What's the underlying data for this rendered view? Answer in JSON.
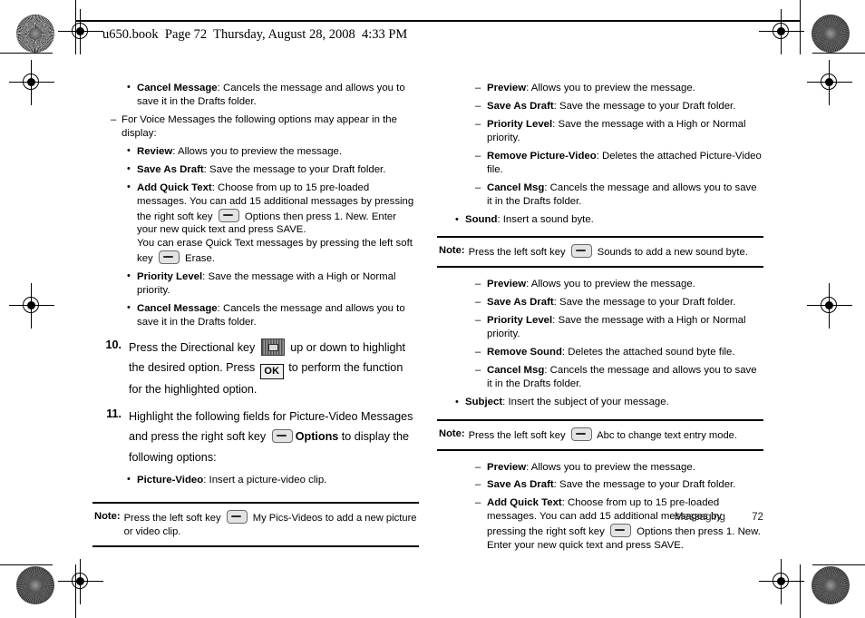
{
  "page": {
    "header_text": "u650.book  Page 72  Thursday, August 28, 2008  4:33 PM",
    "footer_chapter": "Messaging",
    "footer_pageno": "72"
  },
  "icons": {
    "soft_key": "soft-key-icon",
    "ok_key_label": "OK",
    "nav_key": "directional-key-icon"
  },
  "left_column": {
    "cancel_message_top": {
      "marker": "•",
      "term": "Cancel Message",
      "text": ": Cancels the message and allows you to save it in the Drafts folder."
    },
    "voice_intro": {
      "marker": "–",
      "text": "For Voice Messages the following options may appear in the display:"
    },
    "voice_options": [
      {
        "marker": "•",
        "term": "Review",
        "text": ": Allows you to preview the message."
      },
      {
        "marker": "•",
        "term": "Save As Draft",
        "text": ": Save the message to your Draft folder."
      }
    ],
    "add_quick_text": {
      "marker": "•",
      "term": "Add Quick Text",
      "part1": ": Choose from up to 15 pre-loaded messages. You can add 15 additional messages by pressing the right soft key ",
      "part2": " Options then press 1. New. Enter your new quick text and press SAVE.",
      "part3": "You can erase Quick Text messages by pressing the left soft key ",
      "part4": " Erase."
    },
    "voice_options_tail": [
      {
        "marker": "•",
        "term": "Priority Level",
        "text": ": Save the message with a High or Normal priority."
      },
      {
        "marker": "•",
        "term": "Cancel Message",
        "text": ": Cancels the message and allows you to save it in the Drafts folder."
      }
    ],
    "step10": {
      "num": "10.",
      "part1": "Press the Directional key ",
      "part2": " up or down to highlight the desired option. Press ",
      "part3": " to perform the function for the highlighted option."
    },
    "step11": {
      "num": "11.",
      "part1": "Highlight the following fields for Picture-Video Messages and press the right soft key ",
      "options_label": "Options",
      "part2": " to display the following options:"
    },
    "picture_video": {
      "marker": "•",
      "term": "Picture-Video",
      "text": ": Insert a picture-video clip."
    },
    "note1": {
      "label": "Note:",
      "part1": "Press the left soft key ",
      "part2": " My Pics-Videos to add a new picture or video clip."
    }
  },
  "right_column": {
    "picture_video_options": [
      {
        "marker": "–",
        "term": "Preview",
        "text": ": Allows you to preview the message."
      },
      {
        "marker": "–",
        "term": "Save As Draft",
        "text": ": Save the message to your Draft folder."
      },
      {
        "marker": "–",
        "term": "Priority Level",
        "text": ": Save the message with a High or Normal priority."
      },
      {
        "marker": "–",
        "term": "Remove Picture-Video",
        "text": ": Deletes the attached Picture-Video file."
      },
      {
        "marker": "–",
        "term": "Cancel Msg",
        "text": ": Cancels the message and allows you to save it in the Drafts folder."
      }
    ],
    "sound_item": {
      "marker": "•",
      "term": "Sound",
      "text": ": Insert a sound byte."
    },
    "note_sound": {
      "label": "Note:",
      "part1": "Press the left soft key ",
      "part2": " Sounds to add a new sound byte."
    },
    "sound_options": [
      {
        "marker": "–",
        "term": "Preview",
        "text": ": Allows you to preview the message."
      },
      {
        "marker": "–",
        "term": "Save As Draft",
        "text": ": Save the message to your Draft folder."
      },
      {
        "marker": "–",
        "term": "Priority Level",
        "text": ": Save the message with a High or Normal priority."
      },
      {
        "marker": "–",
        "term": "Remove Sound",
        "text": ": Deletes the attached sound byte file."
      },
      {
        "marker": "–",
        "term": "Cancel Msg",
        "text": ": Cancels the message and allows you to save it in the Drafts folder."
      }
    ],
    "subject_item": {
      "marker": "•",
      "term": "Subject",
      "text": ": Insert the subject of your message."
    },
    "note_abc": {
      "label": "Note:",
      "part1": "Press the left soft key ",
      "part2": " Abc to change text entry mode."
    },
    "subject_options": [
      {
        "marker": "–",
        "term": "Preview",
        "text": ": Allows you to preview the message."
      },
      {
        "marker": "–",
        "term": "Save As Draft",
        "text": ": Save the message to your Draft folder."
      }
    ],
    "add_quick_text": {
      "marker": "–",
      "term": "Add Quick Text",
      "part1": ": Choose from up to 15 pre-loaded messages. You can add 15 additional messages by pressing the right soft key ",
      "part2": " Options then press 1. New. Enter your new quick text and press SAVE."
    }
  }
}
